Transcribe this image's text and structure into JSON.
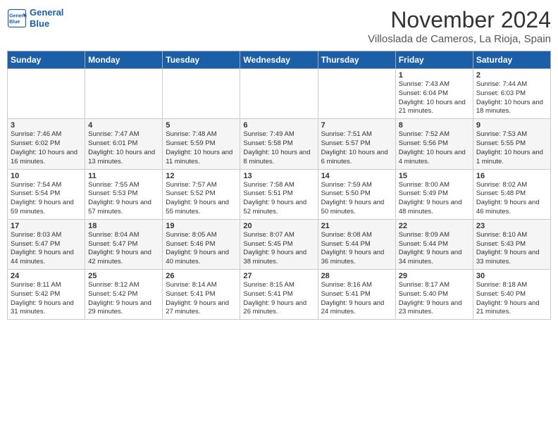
{
  "header": {
    "logo_line1": "General",
    "logo_line2": "Blue",
    "title": "November 2024",
    "subtitle": "Villoslada de Cameros, La Rioja, Spain"
  },
  "weekdays": [
    "Sunday",
    "Monday",
    "Tuesday",
    "Wednesday",
    "Thursday",
    "Friday",
    "Saturday"
  ],
  "weeks": [
    [
      {
        "day": "",
        "info": ""
      },
      {
        "day": "",
        "info": ""
      },
      {
        "day": "",
        "info": ""
      },
      {
        "day": "",
        "info": ""
      },
      {
        "day": "",
        "info": ""
      },
      {
        "day": "1",
        "info": "Sunrise: 7:43 AM\nSunset: 6:04 PM\nDaylight: 10 hours and 21 minutes."
      },
      {
        "day": "2",
        "info": "Sunrise: 7:44 AM\nSunset: 6:03 PM\nDaylight: 10 hours and 18 minutes."
      }
    ],
    [
      {
        "day": "3",
        "info": "Sunrise: 7:46 AM\nSunset: 6:02 PM\nDaylight: 10 hours and 16 minutes."
      },
      {
        "day": "4",
        "info": "Sunrise: 7:47 AM\nSunset: 6:01 PM\nDaylight: 10 hours and 13 minutes."
      },
      {
        "day": "5",
        "info": "Sunrise: 7:48 AM\nSunset: 5:59 PM\nDaylight: 10 hours and 11 minutes."
      },
      {
        "day": "6",
        "info": "Sunrise: 7:49 AM\nSunset: 5:58 PM\nDaylight: 10 hours and 8 minutes."
      },
      {
        "day": "7",
        "info": "Sunrise: 7:51 AM\nSunset: 5:57 PM\nDaylight: 10 hours and 6 minutes."
      },
      {
        "day": "8",
        "info": "Sunrise: 7:52 AM\nSunset: 5:56 PM\nDaylight: 10 hours and 4 minutes."
      },
      {
        "day": "9",
        "info": "Sunrise: 7:53 AM\nSunset: 5:55 PM\nDaylight: 10 hours and 1 minute."
      }
    ],
    [
      {
        "day": "10",
        "info": "Sunrise: 7:54 AM\nSunset: 5:54 PM\nDaylight: 9 hours and 59 minutes."
      },
      {
        "day": "11",
        "info": "Sunrise: 7:55 AM\nSunset: 5:53 PM\nDaylight: 9 hours and 57 minutes."
      },
      {
        "day": "12",
        "info": "Sunrise: 7:57 AM\nSunset: 5:52 PM\nDaylight: 9 hours and 55 minutes."
      },
      {
        "day": "13",
        "info": "Sunrise: 7:58 AM\nSunset: 5:51 PM\nDaylight: 9 hours and 52 minutes."
      },
      {
        "day": "14",
        "info": "Sunrise: 7:59 AM\nSunset: 5:50 PM\nDaylight: 9 hours and 50 minutes."
      },
      {
        "day": "15",
        "info": "Sunrise: 8:00 AM\nSunset: 5:49 PM\nDaylight: 9 hours and 48 minutes."
      },
      {
        "day": "16",
        "info": "Sunrise: 8:02 AM\nSunset: 5:48 PM\nDaylight: 9 hours and 46 minutes."
      }
    ],
    [
      {
        "day": "17",
        "info": "Sunrise: 8:03 AM\nSunset: 5:47 PM\nDaylight: 9 hours and 44 minutes."
      },
      {
        "day": "18",
        "info": "Sunrise: 8:04 AM\nSunset: 5:47 PM\nDaylight: 9 hours and 42 minutes."
      },
      {
        "day": "19",
        "info": "Sunrise: 8:05 AM\nSunset: 5:46 PM\nDaylight: 9 hours and 40 minutes."
      },
      {
        "day": "20",
        "info": "Sunrise: 8:07 AM\nSunset: 5:45 PM\nDaylight: 9 hours and 38 minutes."
      },
      {
        "day": "21",
        "info": "Sunrise: 8:08 AM\nSunset: 5:44 PM\nDaylight: 9 hours and 36 minutes."
      },
      {
        "day": "22",
        "info": "Sunrise: 8:09 AM\nSunset: 5:44 PM\nDaylight: 9 hours and 34 minutes."
      },
      {
        "day": "23",
        "info": "Sunrise: 8:10 AM\nSunset: 5:43 PM\nDaylight: 9 hours and 33 minutes."
      }
    ],
    [
      {
        "day": "24",
        "info": "Sunrise: 8:11 AM\nSunset: 5:42 PM\nDaylight: 9 hours and 31 minutes."
      },
      {
        "day": "25",
        "info": "Sunrise: 8:12 AM\nSunset: 5:42 PM\nDaylight: 9 hours and 29 minutes."
      },
      {
        "day": "26",
        "info": "Sunrise: 8:14 AM\nSunset: 5:41 PM\nDaylight: 9 hours and 27 minutes."
      },
      {
        "day": "27",
        "info": "Sunrise: 8:15 AM\nSunset: 5:41 PM\nDaylight: 9 hours and 26 minutes."
      },
      {
        "day": "28",
        "info": "Sunrise: 8:16 AM\nSunset: 5:41 PM\nDaylight: 9 hours and 24 minutes."
      },
      {
        "day": "29",
        "info": "Sunrise: 8:17 AM\nSunset: 5:40 PM\nDaylight: 9 hours and 23 minutes."
      },
      {
        "day": "30",
        "info": "Sunrise: 8:18 AM\nSunset: 5:40 PM\nDaylight: 9 hours and 21 minutes."
      }
    ]
  ]
}
